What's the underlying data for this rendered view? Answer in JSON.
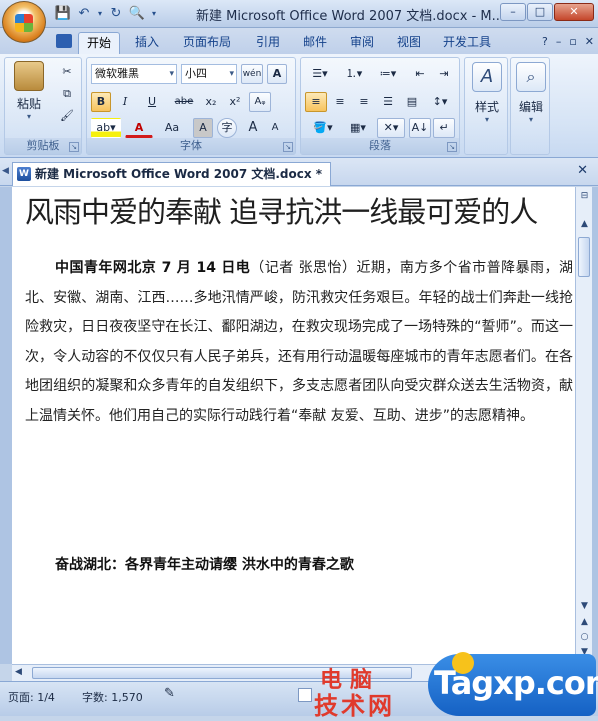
{
  "window": {
    "title": "新建 Microsoft Office Word 2007 文档.docx - M...",
    "controls": [
      "–",
      "□",
      "✕"
    ]
  },
  "ribbon_tabs": [
    "开始",
    "插入",
    "页面布局",
    "引用",
    "邮件",
    "审阅",
    "视图",
    "开发工具"
  ],
  "ribbon": {
    "clipboard": {
      "paste": "粘贴",
      "label": "剪贴板"
    },
    "font": {
      "font_name": "微软雅黑",
      "font_size": "小四",
      "label": "字体",
      "buttons": [
        "B",
        "I",
        "U",
        "abe",
        "x₂",
        "x²",
        "A",
        "Aa",
        "A",
        "A",
        "A"
      ]
    },
    "paragraph": {
      "label": "段落"
    },
    "styles": {
      "label": "样式"
    },
    "editing": {
      "label": "编辑"
    }
  },
  "document_tab": {
    "name": "新建 Microsoft Office Word 2007 文档.docx *"
  },
  "document": {
    "heading": "风雨中爱的奉献 追寻抗洪一线最可爱的人",
    "lead_bold": "中国青年网北京 7 月 14 日电",
    "body": "（记者 张思怡）近期，南方多个省市普降暴雨，湖北、安徽、湖南、江西……多地汛情严峻，防汛救灾任务艰巨。年轻的战士们奔赴一线抢险救灾，日日夜夜坚守在长江、鄱阳湖边，在救灾现场完成了一场特殊的“誓师”。而这一次，令人动容的不仅仅只有人民子弟兵，还有用行动温暖每座城市的青年志愿者们。在各地团组织的凝聚和众多青年的自发组织下，多支志愿者团队向受灾群众送去生活物资，献上温情关怀。他们用自己的实际行动践行着“奉献 友爱、互助、进步”的志愿精神。",
    "subheading": "奋战湖北：各界青年主动请缨 洪水中的青春之歌"
  },
  "statusbar": {
    "page": "页面: 1/4",
    "words": "字数: 1,570"
  },
  "watermark": {
    "cn_line1": "电脑",
    "cn_line2": "技术网",
    "en": "Tagxp.com"
  }
}
